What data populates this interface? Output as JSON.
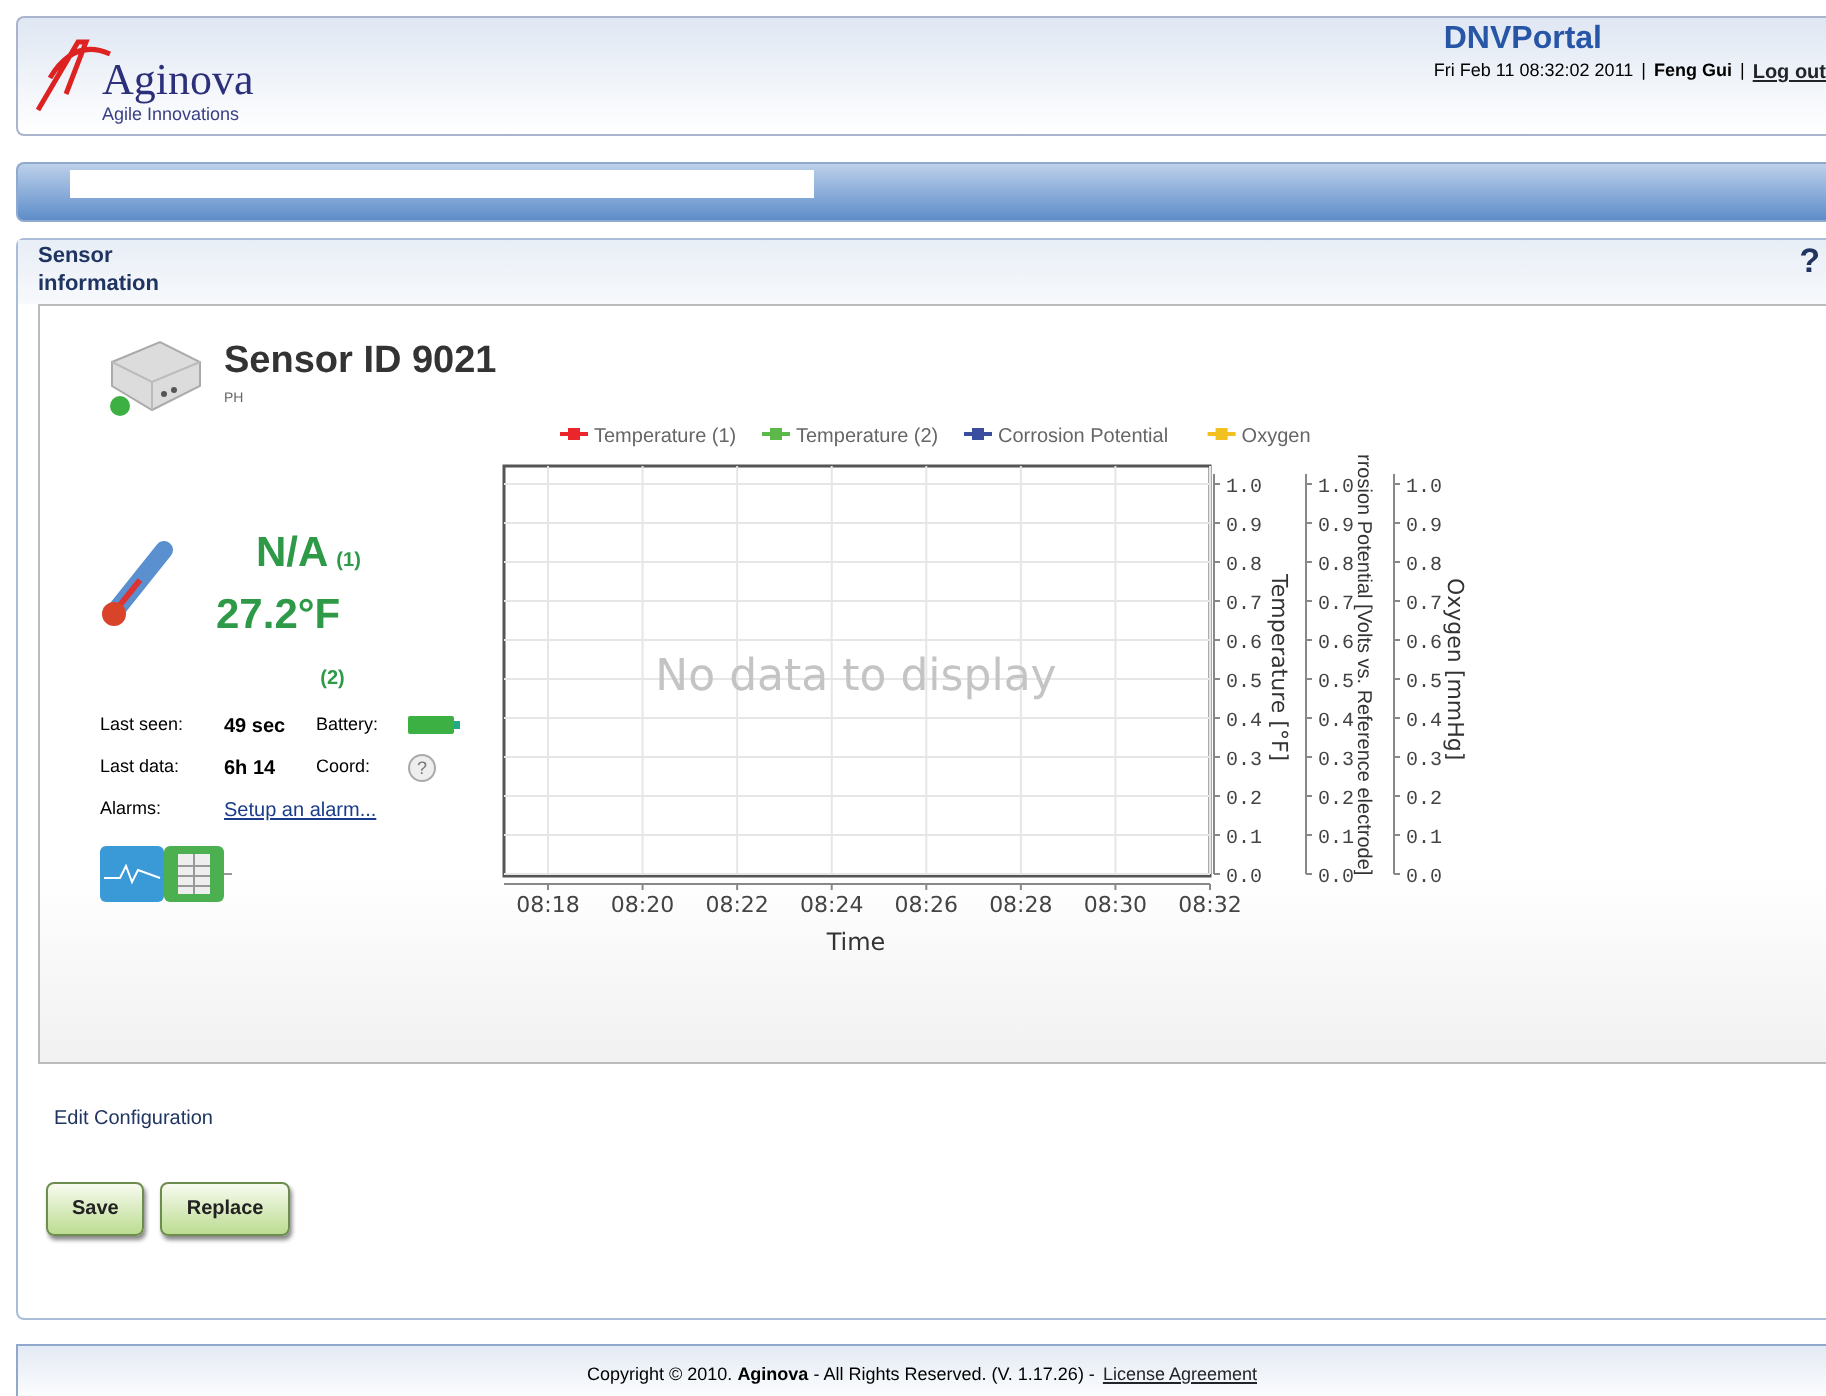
{
  "header": {
    "logo": {
      "name": "Aginova",
      "tagline": "Agile Innovations"
    },
    "portal": "DNVPortal",
    "separators": [
      "|",
      "|"
    ],
    "datetime": "Fri Feb 11 08:32:02 2011",
    "user": "Feng Gui",
    "logout": "Log out"
  },
  "panel": {
    "title": "Sensor information",
    "help": "?",
    "sensor": {
      "title": "Sensor ID 9021",
      "type": "PH",
      "online": true,
      "readings": [
        {
          "value": "N/A",
          "index": "(1)"
        },
        {
          "value": "27.2°F",
          "index": "(2)"
        }
      ],
      "details": [
        {
          "label": "Last seen:",
          "value": "49 sec",
          "label2": "Battery:",
          "kind": "battery"
        },
        {
          "label": "Last data:",
          "value": "6h 14",
          "label2": "Coord:",
          "kind": "help",
          "value2": "?"
        },
        {
          "label": "Alarms:",
          "link": "Setup an alarm...",
          "kind": "link"
        }
      ]
    },
    "chart": {
      "empty_message": "No data to display",
      "chart_data": {
        "type": "line",
        "xlabel": "Time",
        "ylabel": "Temperature [°F]",
        "grid": true,
        "categories": [
          "08:18",
          "08:20",
          "08:22",
          "08:24",
          "08:26",
          "08:28",
          "08:30",
          "08:32"
        ],
        "ylim": [
          0,
          1
        ],
        "yticks": [
          {
            "value": 0,
            "label": "0.0"
          },
          {
            "value": 0.1,
            "label": "0.1"
          },
          {
            "value": 0.2,
            "label": "0.2"
          },
          {
            "value": 0.3,
            "label": "0.3"
          },
          {
            "value": 0.4,
            "label": "0.4"
          },
          {
            "value": 0.5,
            "label": "0.5"
          },
          {
            "value": 0.6,
            "label": "0.6"
          },
          {
            "value": 0.7,
            "label": "0.7"
          },
          {
            "value": 0.8,
            "label": "0.8"
          },
          {
            "value": 0.9,
            "label": "0.9"
          },
          {
            "value": 1,
            "label": "1.0"
          }
        ],
        "series": [
          {
            "name": "Temperature (1)",
            "color": "#e8262b",
            "values": [
              null,
              null,
              null,
              null,
              null,
              null,
              null,
              null
            ]
          },
          {
            "name": "Temperature (2)",
            "color": "#5cb848",
            "values": [
              null,
              null,
              null,
              null,
              null,
              null,
              null,
              null
            ]
          },
          {
            "name": "Corrosion Potential",
            "color": "#3a4ea0",
            "values": [
              null,
              null,
              null,
              null,
              null,
              null,
              null,
              null
            ]
          },
          {
            "name": "Oxygen",
            "color": "#f3c021",
            "values": [
              null,
              null,
              null,
              null,
              null,
              null,
              null,
              null
            ]
          }
        ]
      },
      "extra_axes": [
        {
          "label": "rrosion Potential [Volts vs. Reference electrode]",
          "ticks": [
            "1.0",
            "0.9",
            "0.8",
            "0.7",
            "0.6",
            "0.5",
            "0.4",
            "0.3",
            "0.2",
            "0.1",
            "0.0"
          ]
        },
        {
          "label": "Oxygen [mmHg]",
          "ticks": [
            "1.0",
            "0.9",
            "0.8",
            "0.7",
            "0.6",
            "0.5",
            "0.4",
            "0.3",
            "0.2",
            "0.1",
            "0.0"
          ]
        }
      ]
    },
    "edit_link": "Edit Configuration",
    "buttons": [
      "Save",
      "Replace"
    ]
  },
  "footer": {
    "copyright": "Copyright © 2010. **Aginova** - All Rights Reserved. (V. 1.17.26) - ",
    "license": "License Agreement"
  }
}
